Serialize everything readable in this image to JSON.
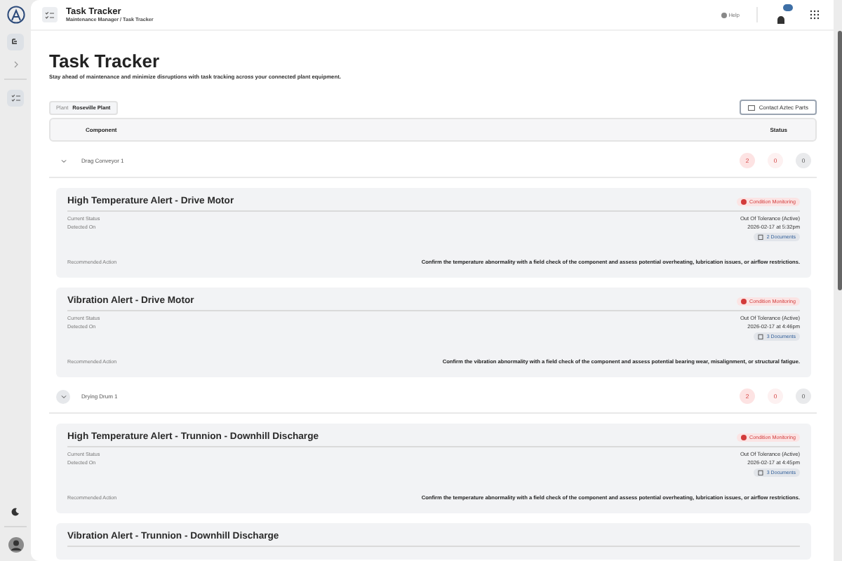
{
  "header": {
    "title": "Task Tracker",
    "breadcrumb": "Maintenance Manager / Task Tracker",
    "help": "Help"
  },
  "page": {
    "title": "Task Tracker",
    "subtitle": "Stay ahead of maintenance and minimize disruptions with task tracking across your connected plant equipment.",
    "filter": {
      "label": "Plant",
      "value": "Roseville Plant"
    },
    "contact_button": "Contact Aztec Parts"
  },
  "table": {
    "columns": [
      "Component",
      "Status"
    ],
    "groups": [
      {
        "name": "Drag Conveyor 1",
        "expanded": true,
        "hovered": false,
        "counts": [
          {
            "kind": "critical",
            "value": "2"
          },
          {
            "kind": "warning",
            "value": "0"
          },
          {
            "kind": "ok",
            "value": "0"
          }
        ],
        "alerts": [
          {
            "title": "High Temperature Alert - Drive Motor",
            "category": "Condition Monitoring",
            "status_label": "Current Status",
            "status": "Out Of Tolerance (Active)",
            "detected_label": "Detected On",
            "detected": "2026-02-17 at 5:32pm",
            "documents": "2 Documents",
            "action_label": "Recommended Action",
            "action": "Confirm the temperature abnormality with a field check of the component and assess potential overheating, lubrication issues, or airflow restrictions."
          },
          {
            "title": "Vibration Alert - Drive Motor",
            "category": "Condition Monitoring",
            "status_label": "Current Status",
            "status": "Out Of Tolerance (Active)",
            "detected_label": "Detected On",
            "detected": "2026-02-17 at 4:46pm",
            "documents": "3 Documents",
            "action_label": "Recommended Action",
            "action": "Confirm the vibration abnormality with a field check of the component and assess potential bearing wear, misalignment, or structural fatigue."
          }
        ]
      },
      {
        "name": "Drying Drum 1",
        "expanded": true,
        "hovered": true,
        "counts": [
          {
            "kind": "critical",
            "value": "2"
          },
          {
            "kind": "warning",
            "value": "0"
          },
          {
            "kind": "ok",
            "value": "0"
          }
        ],
        "alerts": [
          {
            "title": "High Temperature Alert - Trunnion - Downhill Discharge",
            "category": "Condition Monitoring",
            "status_label": "Current Status",
            "status": "Out Of Tolerance (Active)",
            "detected_label": "Detected On",
            "detected": "2026-02-17 at 4:45pm",
            "documents": "3 Documents",
            "action_label": "Recommended Action",
            "action": "Confirm the temperature abnormality with a field check of the component and assess potential overheating, lubrication issues, or airflow restrictions."
          },
          {
            "title": "Vibration Alert - Trunnion - Downhill Discharge"
          }
        ]
      }
    ]
  }
}
